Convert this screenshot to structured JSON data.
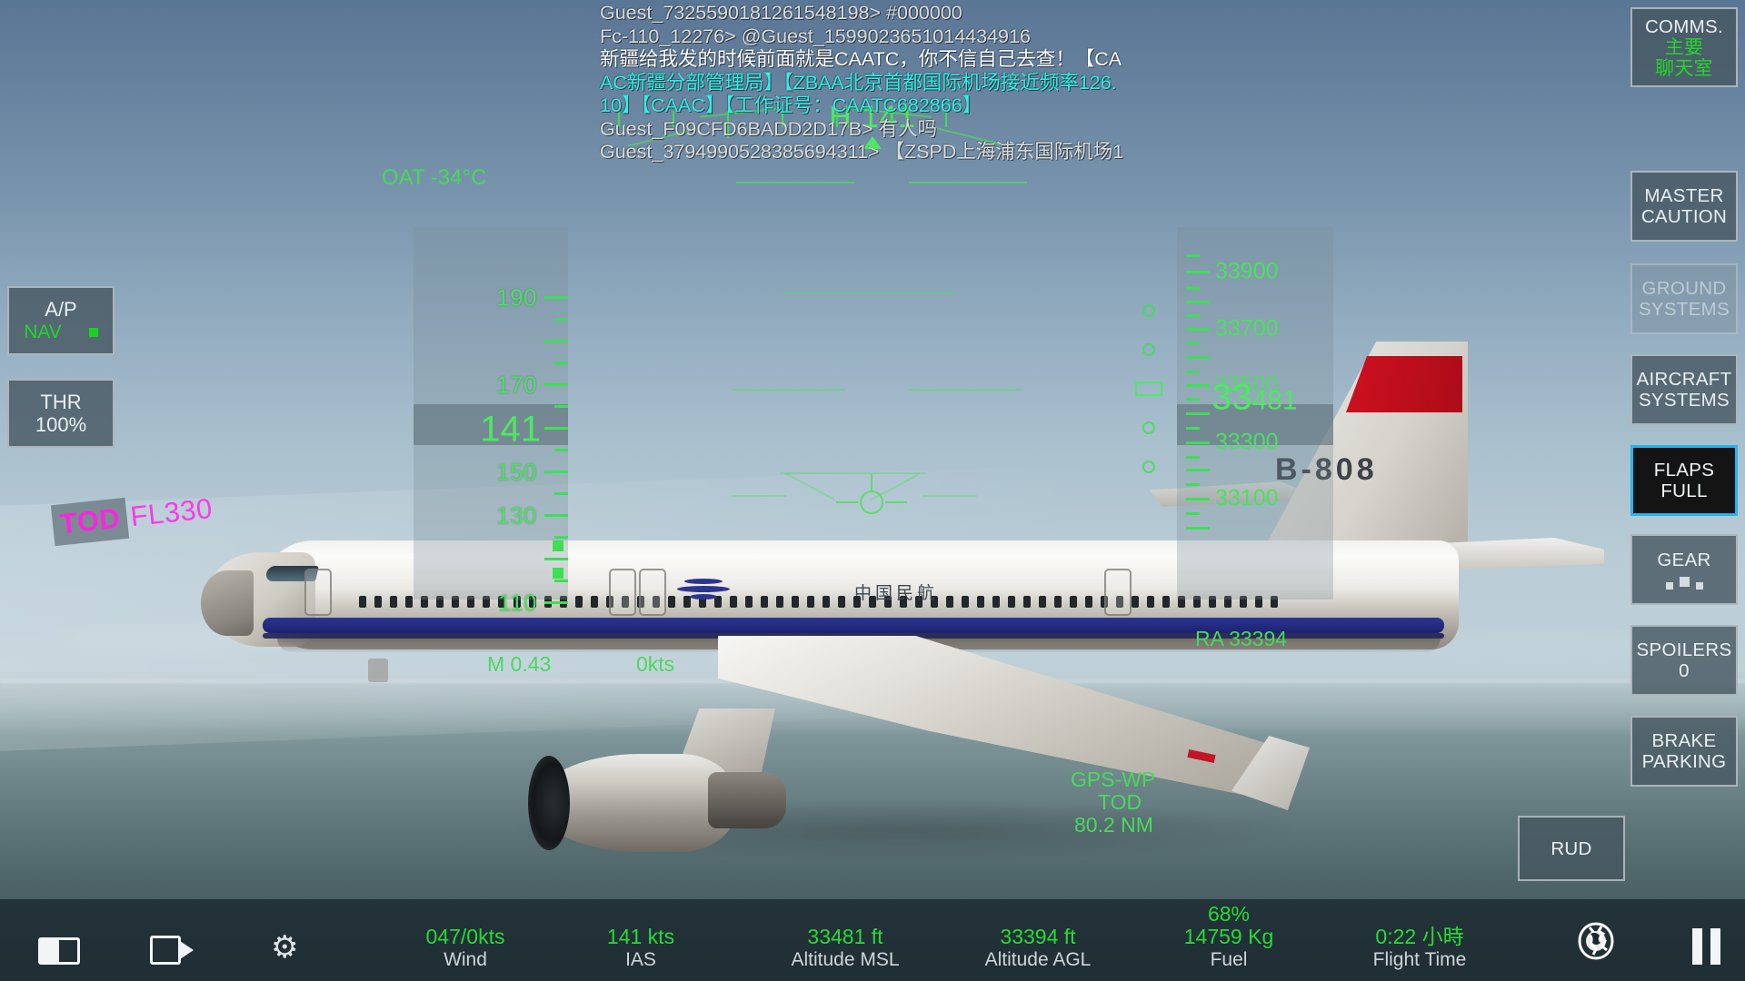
{
  "chat": {
    "lines": [
      {
        "text": "Guest_7325590181261548198> #000000",
        "color": "grey"
      },
      {
        "text": "Fc-110_12276> @Guest_1599023651014434916",
        "color": "grey"
      },
      {
        "text": "新疆给我发的时候前面就是CAATC，你不信自己去查！【CA",
        "color": "white"
      },
      {
        "text": "AC新疆分部管理局】【ZBAA北京首都国际机场接近频率126.",
        "color": "cyan"
      },
      {
        "text": "10】【CAAC】【工作证号：CAATC682866】",
        "color": "cyan"
      },
      {
        "text": "Guest_F09CFD6BADD2D17B> 有人吗",
        "color": "grey"
      },
      {
        "text": "Guest_3794990528385694311> 【ZSPD上海浦东国际机场1",
        "color": "grey"
      }
    ]
  },
  "right_panel": {
    "buttons": [
      {
        "name": "comms",
        "label": "COMMS.",
        "sub_cn_1": "主要",
        "sub_cn_2": "聊天室",
        "state": "normal"
      },
      {
        "name": "master-caution",
        "label": "MASTER",
        "line2": "CAUTION",
        "state": "normal"
      },
      {
        "name": "ground-systems",
        "label": "GROUND",
        "line2": "SYSTEMS",
        "state": "dim"
      },
      {
        "name": "aircraft-systems",
        "label": "AIRCRAFT",
        "line2": "SYSTEMS",
        "state": "normal"
      },
      {
        "name": "flaps",
        "label": "FLAPS",
        "line2": "FULL",
        "state": "active"
      },
      {
        "name": "gear",
        "label": "GEAR",
        "line2": "",
        "state": "normal"
      },
      {
        "name": "spoilers",
        "label": "SPOILERS",
        "line2": "0",
        "state": "normal"
      },
      {
        "name": "brake",
        "label": "BRAKE",
        "line2": "PARKING",
        "state": "normal"
      },
      {
        "name": "rudder",
        "label": "RUD",
        "line2": "",
        "state": "normal"
      }
    ]
  },
  "left_panel": {
    "autopilot": {
      "label": "A/P",
      "mode": "NAV"
    },
    "throttle": {
      "label": "THR",
      "value": "100%"
    }
  },
  "hud": {
    "oat": "OAT -34°C",
    "heading_label": "H",
    "heading_value": "141",
    "heading_full": "H 141",
    "speed_current": "141",
    "speed_ticks": [
      "190",
      "170",
      "150",
      "130",
      "110"
    ],
    "altitude_current_big": "33",
    "altitude_current_small": "481",
    "altitude_ticks": [
      "33900",
      "33700",
      "33500",
      "33300",
      "33100"
    ],
    "mach": "M 0.43",
    "vs": "0kts",
    "tod_chip": "TOD",
    "tod_fl": "FL330",
    "gps_wp_label": "GPS-WP",
    "gps_wp_name": "TOD",
    "gps_wp_dist": "80.2 NM",
    "ra_alt": "RA 33394"
  },
  "aircraft": {
    "registration": "B-808",
    "livery_text": "中国民航"
  },
  "bottom_bar": {
    "stats": [
      {
        "name": "wind",
        "value": "047/0kts",
        "label": "Wind"
      },
      {
        "name": "ias",
        "value": "141 kts",
        "label": "IAS"
      },
      {
        "name": "altitude-msl",
        "value": "33481 ft",
        "label": "Altitude MSL"
      },
      {
        "name": "altitude-agl",
        "value": "33394 ft",
        "label": "Altitude AGL"
      },
      {
        "name": "fuel",
        "value": "68%",
        "value2": "14759 Kg",
        "label": "Fuel"
      },
      {
        "name": "flight-time",
        "value": "0:22 小時",
        "label": "Flight Time"
      }
    ]
  }
}
